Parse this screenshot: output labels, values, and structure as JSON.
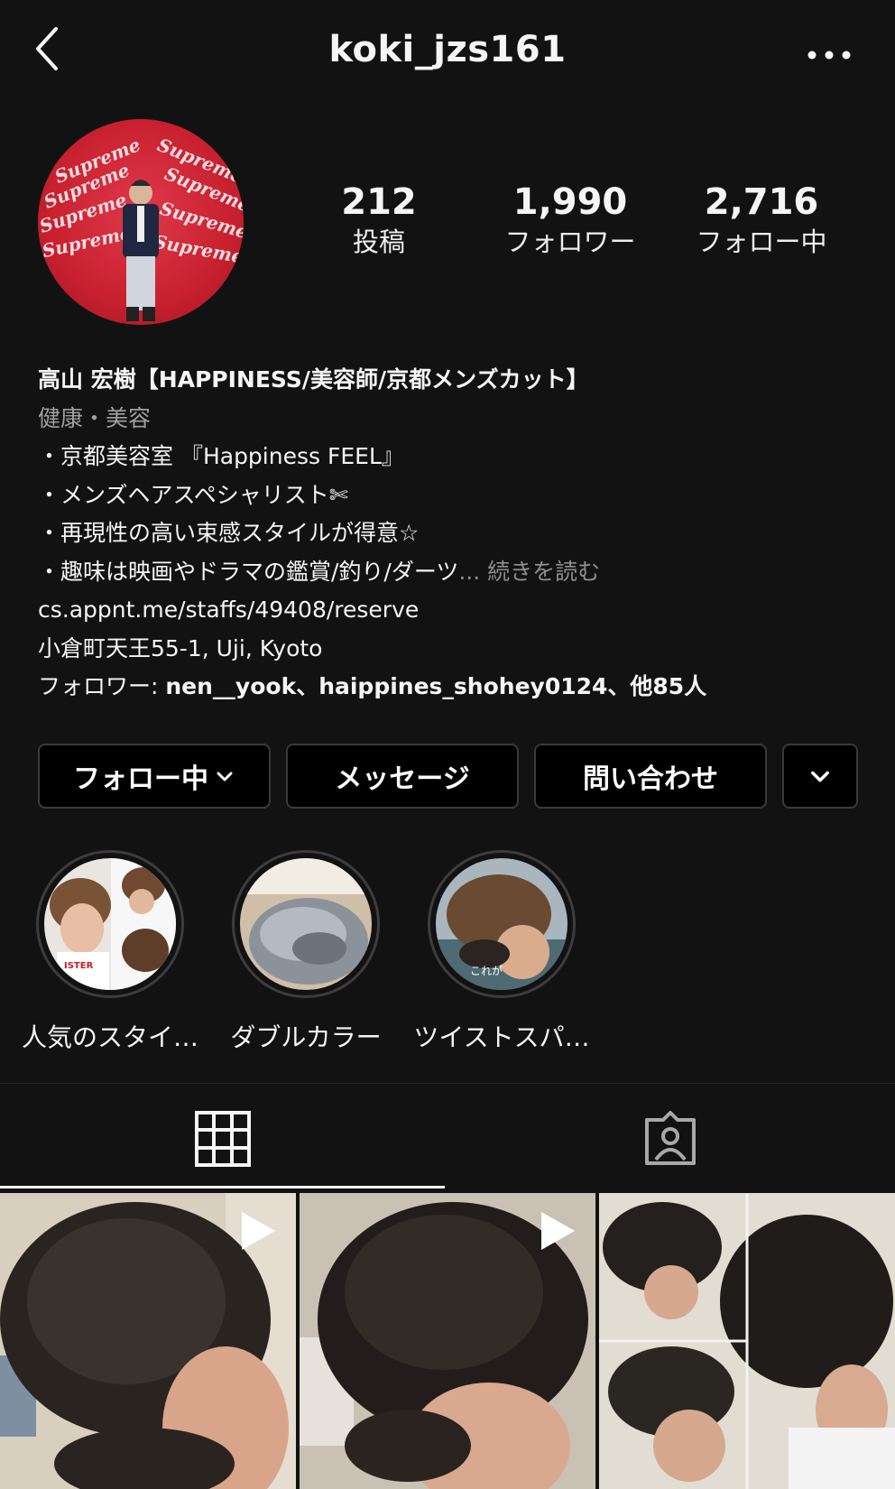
{
  "header": {
    "username": "koki_jzs161"
  },
  "stats": {
    "posts": {
      "value": "212",
      "label": "投稿"
    },
    "followers": {
      "value": "1,990",
      "label": "フォロワー"
    },
    "following": {
      "value": "2,716",
      "label": "フォロー中"
    }
  },
  "avatar": {
    "text": "Supreme"
  },
  "bio": {
    "name": "高山 宏樹【HAPPINESS/美容師/京都メンズカット】",
    "category": "健康・美容",
    "lines": [
      "・京都美容室 『Happiness FEEL』",
      "・メンズヘアスペシャリスト✄",
      "・再現性の高い束感スタイルが得意☆",
      "・趣味は映画やドラマの鑑賞/釣り/ダーツ"
    ],
    "ellipsis": "...",
    "read_more": " 続きを読む",
    "link": "cs.appnt.me/staffs/49408/reserve",
    "address": "小倉町天王55-1, Uji, Kyoto",
    "followed_by_prefix": "フォロワー: ",
    "followed_by": "nen__yook、haippines_shohey0124、他85人"
  },
  "actions": {
    "following": "フォロー中",
    "message": "メッセージ",
    "contact": "問い合わせ"
  },
  "highlights": [
    {
      "label": "人気のスタイ…"
    },
    {
      "label": "ダブルカラー"
    },
    {
      "label": "ツイストスパ…",
      "overlay_text": "これが"
    }
  ],
  "icons": {
    "back": "chevron-left-icon",
    "more": "more-horizontal-icon",
    "grid": "grid-icon",
    "tagged": "tagged-person-icon",
    "play": "play-icon"
  },
  "colors": {
    "background": "#121212",
    "button_bg": "#000000",
    "avatar_red": "#d12a39"
  }
}
